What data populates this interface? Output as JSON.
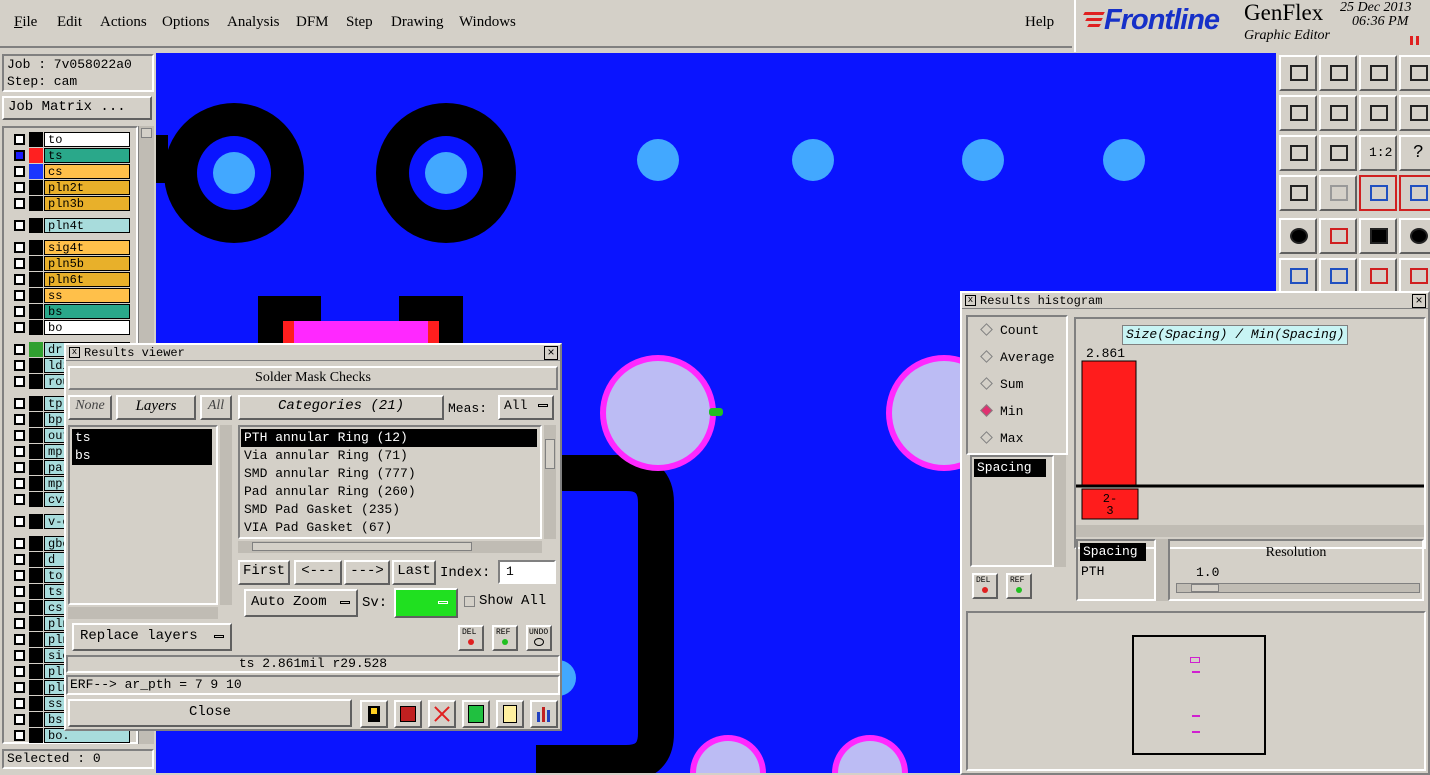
{
  "menu": {
    "file": "File",
    "edit": "Edit",
    "actions": "Actions",
    "options": "Options",
    "analysis": "Analysis",
    "dfm": "DFM",
    "step": "Step",
    "drawing": "Drawing",
    "windows": "Windows",
    "help": "Help"
  },
  "logo": {
    "brand": "Frontline",
    "product": "GenFlex",
    "subtitle": "Graphic Editor",
    "date": "25 Dec 2013",
    "time": "06:36 PM"
  },
  "left": {
    "job": "Job : 7v058022a0",
    "step": "Step: cam",
    "job_matrix": "Job Matrix ...",
    "selected": "Selected : 0",
    "layers": [
      {
        "name": "to",
        "color": "#ffffff",
        "sw": "#000000"
      },
      {
        "name": "ts",
        "color": "#2aa88a",
        "sw": "#ff2020"
      },
      {
        "name": "cs",
        "color": "#ffc04a",
        "sw": "#1a36ff"
      },
      {
        "name": "pln2t",
        "color": "#e8b02a",
        "sw": "#000000"
      },
      {
        "name": "pln3b",
        "color": "#e8b02a",
        "sw": "#000000"
      },
      {
        "name": "pln4t",
        "color": "#a8dcdc",
        "sw": "#000000"
      },
      {
        "name": "sig4t",
        "color": "#ffc04a",
        "sw": "#000000"
      },
      {
        "name": "pln5b",
        "color": "#e8b02a",
        "sw": "#000000"
      },
      {
        "name": "pln6t",
        "color": "#e8b02a",
        "sw": "#000000"
      },
      {
        "name": "ss",
        "color": "#ffc04a",
        "sw": "#000000"
      },
      {
        "name": "bs",
        "color": "#2aa88a",
        "sw": "#000000"
      },
      {
        "name": "bo",
        "color": "#ffffff",
        "sw": "#000000"
      },
      {
        "name": "dr",
        "color": "#a8dcdc",
        "sw": "#30a030"
      },
      {
        "name": "ldi",
        "color": "#a8dcdc",
        "sw": "#000000"
      },
      {
        "name": "rou",
        "color": "#a8dcdc",
        "sw": "#000000"
      },
      {
        "name": "tp",
        "color": "#a8dcdc",
        "sw": "#000000"
      },
      {
        "name": "bp",
        "color": "#a8dcdc",
        "sw": "#000000"
      },
      {
        "name": "out",
        "color": "#a8dcdc",
        "sw": "#000000"
      },
      {
        "name": "mp-",
        "color": "#a8dcdc",
        "sw": "#000000"
      },
      {
        "name": "par",
        "color": "#a8dcdc",
        "sw": "#000000"
      },
      {
        "name": "mpt",
        "color": "#a8dcdc",
        "sw": "#000000"
      },
      {
        "name": "cvi",
        "color": "#a8dcdc",
        "sw": "#000000"
      },
      {
        "name": "v-c",
        "color": "#a8dcdc",
        "sw": "#000000"
      },
      {
        "name": "gbo",
        "color": "#a8dcdc",
        "sw": "#000000"
      },
      {
        "name": "d",
        "color": "#a8dcdc",
        "sw": "#000000"
      },
      {
        "name": "to.",
        "color": "#a8dcdc",
        "sw": "#000000"
      },
      {
        "name": "ts.",
        "color": "#a8dcdc",
        "sw": "#000000"
      },
      {
        "name": "cs.",
        "color": "#a8dcdc",
        "sw": "#000000"
      },
      {
        "name": "pln",
        "color": "#a8dcdc",
        "sw": "#000000"
      },
      {
        "name": "pln",
        "color": "#a8dcdc",
        "sw": "#000000"
      },
      {
        "name": "sic",
        "color": "#a8dcdc",
        "sw": "#000000"
      },
      {
        "name": "pln",
        "color": "#a8dcdc",
        "sw": "#000000"
      },
      {
        "name": "pln",
        "color": "#a8dcdc",
        "sw": "#000000"
      },
      {
        "name": "ss.",
        "color": "#a8dcdc",
        "sw": "#000000"
      },
      {
        "name": "bs.",
        "color": "#a8dcdc",
        "sw": "#000000"
      },
      {
        "name": "bo.",
        "color": "#a8dcdc",
        "sw": "#000000"
      }
    ]
  },
  "rv": {
    "title": "Results viewer",
    "header": "Solder Mask Checks",
    "none": "None",
    "layers_label": "Layers",
    "all": "All",
    "categories": "Categories (21)",
    "meas_label": "Meas:",
    "meas_value": "All",
    "layer_items": [
      "ts",
      "bs"
    ],
    "cat_items": [
      "PTH annular Ring (12)",
      "Via annular Ring (71)",
      "SMD annular Ring (777)",
      "Pad annular Ring (260)",
      "SMD Pad Gasket (235)",
      "VIA Pad Gasket (67)"
    ],
    "first": "First",
    "prev": "<---",
    "next": "--->",
    "last": "Last",
    "index_label": "Index:",
    "index_value": "1",
    "auto_zoom": "Auto Zoom",
    "sv": "Sv:",
    "show_all": "Show All",
    "del": "DEL",
    "ref": "REF",
    "undo": "UNDO",
    "replace": "Replace layers",
    "status": "ts 2.861mil  r29.528",
    "erf": "ERF--> ar_pth = 7 9 10",
    "close": "Close"
  },
  "hist": {
    "title": "Results histogram",
    "radios": [
      "Count",
      "Average",
      "Sum",
      "Min",
      "Max"
    ],
    "selected_radio": "Min",
    "chart_title": "Size(Spacing) / Min(Spacing)",
    "list": [
      "Spacing"
    ],
    "del": "DEL",
    "ref": "REF",
    "list2": [
      "Spacing",
      "PTH"
    ],
    "resolution_label": "Resolution",
    "resolution_value": "1.0"
  },
  "chart_data": {
    "type": "bar",
    "title": "Size(Spacing) / Min(Spacing)",
    "categories": [
      "2-3"
    ],
    "values": [
      2.861
    ],
    "value_labels": [
      "2.861"
    ],
    "bar_color": "#ff1c1c"
  }
}
